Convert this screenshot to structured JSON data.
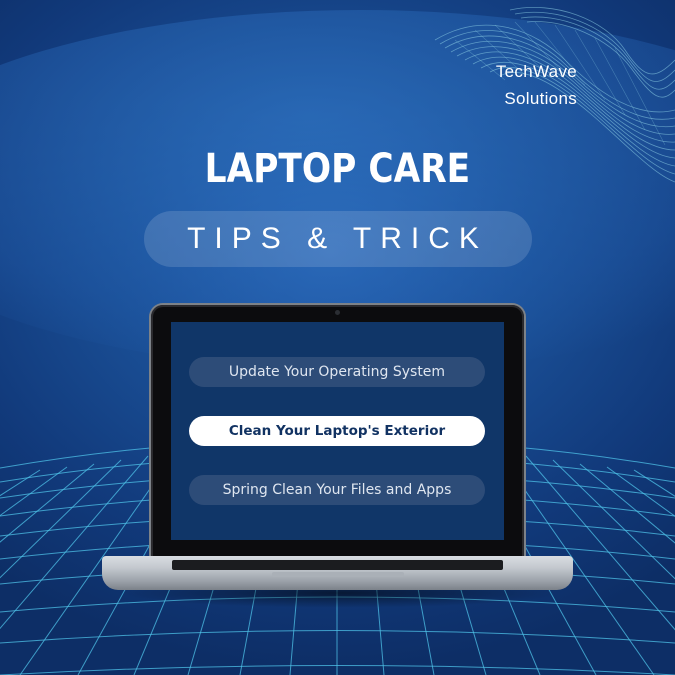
{
  "brand": {
    "line1": "TechWave",
    "line2": "Solutions"
  },
  "title": "LAPTOP CARE",
  "subtitle": "TIPS & TRICK",
  "menu": {
    "items": [
      {
        "label": "Update Your Operating System",
        "active": false
      },
      {
        "label": "Clean Your Laptop's Exterior",
        "active": true
      },
      {
        "label": "Spring Clean Your Files and Apps",
        "active": false
      }
    ]
  },
  "colors": {
    "background": "#1a4f96",
    "screen": "#103668",
    "button_muted": "#2d4c78",
    "button_active": "#ffffff",
    "grid": "#4fc3e8"
  }
}
